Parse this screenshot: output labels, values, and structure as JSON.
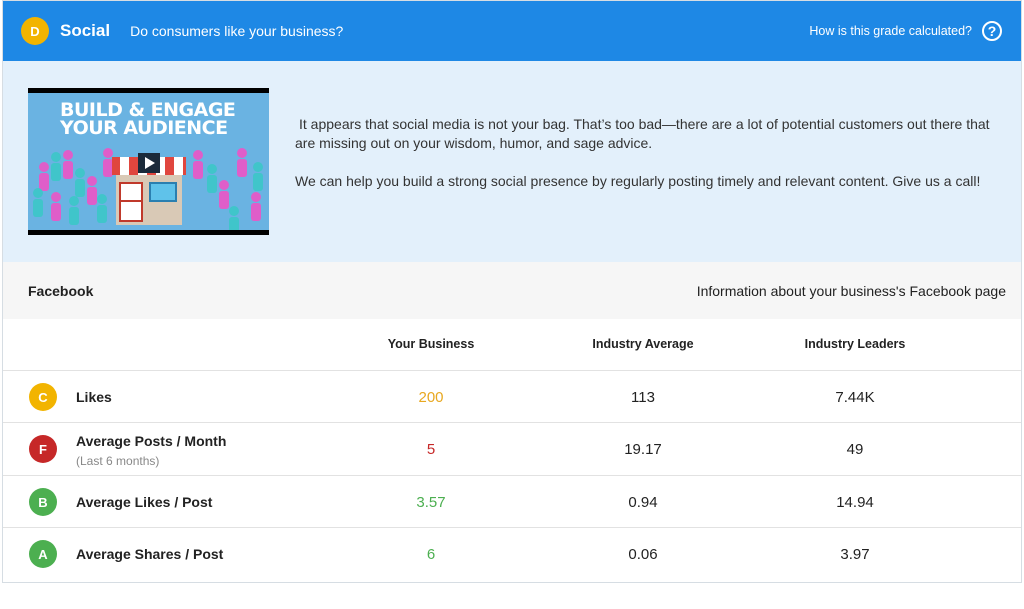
{
  "header": {
    "grade": "D",
    "title": "Social",
    "subtitle": "Do consumers like your business?",
    "help_link": "How is this grade calculated?",
    "help_symbol": "?",
    "grade_color": "#f2b400",
    "bg_color": "#1e88e5"
  },
  "intro": {
    "banner_title_line1": "BUILD & ENGAGE",
    "banner_title_line2": "YOUR AUDIENCE",
    "paragraph1": "It appears that social media is not your bag. That’s too bad—there are a lot of potential customers out there that are missing out on your wisdom, humor, and sage advice.",
    "paragraph2": "We can help you build a strong social presence by regularly posting timely and relevant content. Give us a call!"
  },
  "facebook": {
    "title": "Facebook",
    "info": "Information about your business's Facebook page",
    "columns": [
      "Your Business",
      "Industry Average",
      "Industry Leaders"
    ],
    "rows": [
      {
        "grade": "C",
        "grade_color": "#f2b400",
        "metric": "Likes",
        "note": "",
        "yours": "200",
        "yours_color": "#e8a820",
        "average": "113",
        "leaders": "7.44K"
      },
      {
        "grade": "F",
        "grade_color": "#c62828",
        "metric": "Average Posts / Month",
        "note": "(Last 6 months)",
        "yours": "5",
        "yours_color": "#c62828",
        "average": "19.17",
        "leaders": "49"
      },
      {
        "grade": "B",
        "grade_color": "#4caf50",
        "metric": "Average Likes / Post",
        "note": "",
        "yours": "3.57",
        "yours_color": "#4caf50",
        "average": "0.94",
        "leaders": "14.94"
      },
      {
        "grade": "A",
        "grade_color": "#4caf50",
        "metric": "Average Shares / Post",
        "note": "",
        "yours": "6",
        "yours_color": "#4caf50",
        "average": "0.06",
        "leaders": "3.97"
      }
    ]
  }
}
